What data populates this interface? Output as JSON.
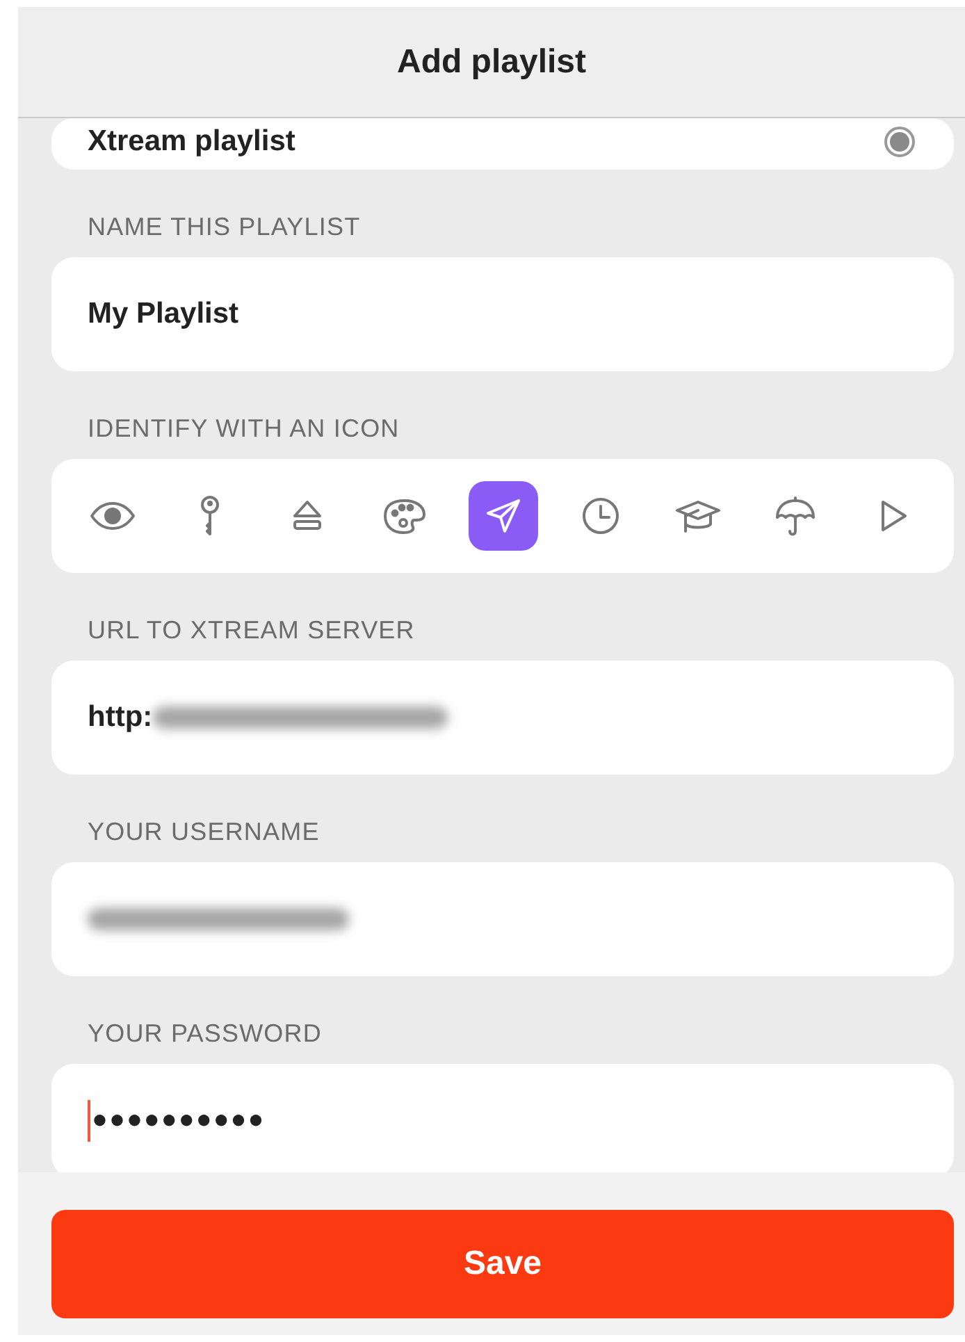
{
  "header": {
    "title": "Add playlist"
  },
  "playlist_type": {
    "label": "Xtream playlist",
    "selected": true
  },
  "name": {
    "label": "NAME THIS PLAYLIST",
    "value": "My Playlist"
  },
  "icon_picker": {
    "label": "IDENTIFY WITH AN ICON",
    "icons": [
      {
        "selected": false
      },
      {
        "selected": false
      },
      {
        "selected": false
      },
      {
        "selected": false
      },
      {
        "selected": true
      },
      {
        "selected": false
      },
      {
        "selected": false
      },
      {
        "selected": false
      },
      {
        "selected": false
      }
    ]
  },
  "url": {
    "label": "URL TO XTREAM SERVER",
    "value": "http:",
    "redacted": true
  },
  "username": {
    "label": "YOUR USERNAME",
    "redacted": true
  },
  "password": {
    "label": "YOUR PASSWORD",
    "value": "●●●●●●●●●●",
    "focused": true
  },
  "save_button": {
    "label": "Save"
  }
}
